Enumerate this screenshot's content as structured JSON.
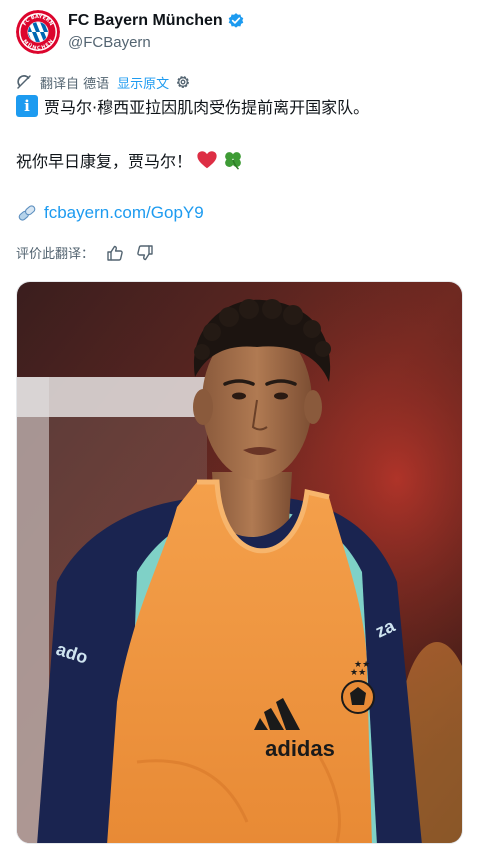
{
  "account": {
    "display_name": "FC Bayern München",
    "handle": "@FCBayern",
    "avatar_icon": "fc-bayern-crest-icon",
    "verified_icon": "verified-badge-icon",
    "verified_color": "#1d9bf0",
    "crest_text_top": "FC BAYERN",
    "crest_text_bottom": "MÜNCHEN"
  },
  "translation": {
    "label": "翻译自 德语",
    "show_original": "显示原文",
    "icon": "translate-icon",
    "settings_icon": "gear-icon"
  },
  "tweet": {
    "info_icon": "information-icon",
    "info_symbol": "i",
    "line1": "贾马尔·穆西亚拉因肌肉受伤提前离开国家队。",
    "line2": "祝你早日康复，贾马尔！",
    "emojis": [
      "red-heart-icon",
      "four-leaf-clover-icon"
    ],
    "link_icon": "link-icon",
    "link_text": "fcbayern.com/GopY9"
  },
  "rating": {
    "label": "评价此翻译：",
    "like_icon": "thumbs-up-icon",
    "dislike_icon": "thumbs-down-icon"
  },
  "media": {
    "description_icon": "player-photo",
    "shirt_brand": "adidas",
    "sleeve_text_left": "ado",
    "sleeve_text_right": "za"
  },
  "colors": {
    "accent": "#1d9bf0",
    "text": "#0f1419",
    "muted": "#536471",
    "bayern_red": "#dc052d"
  }
}
